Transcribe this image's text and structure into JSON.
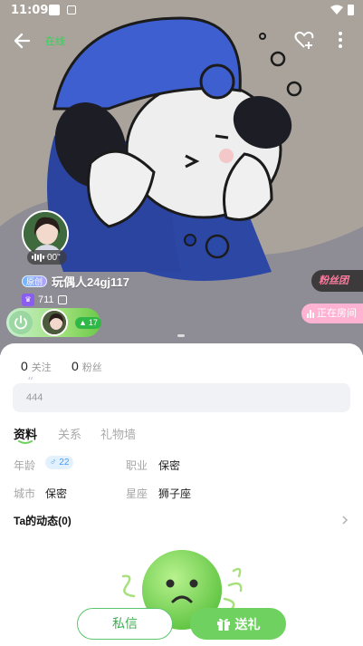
{
  "status_bar": {
    "time": "11:09"
  },
  "header": {
    "online_status": "在线"
  },
  "profile": {
    "voice_duration": "00\"",
    "vip_badge": "原创",
    "nickname": "玩偶人24gj117",
    "wealth_level": "711",
    "hot_count": "17",
    "fans_tag": "粉丝团",
    "in_room_label": "正在房间"
  },
  "stats": {
    "following_count": "0",
    "following_label": "关注",
    "fans_count": "0",
    "fans_label": "粉丝"
  },
  "bio": {
    "quote_mark": "“",
    "text": "444"
  },
  "tabs": [
    {
      "label": "资料",
      "active": true
    },
    {
      "label": "关系",
      "active": false
    },
    {
      "label": "礼物墙",
      "active": false
    }
  ],
  "details": {
    "age_label": "年龄",
    "age_value": "♂ 22",
    "job_label": "职业",
    "job_value": "保密",
    "city_label": "城市",
    "city_value": "保密",
    "sign_label": "星座",
    "sign_value": "狮子座"
  },
  "moments": {
    "title": "Ta的动态(0)"
  },
  "actions": {
    "message_label": "私信",
    "gift_label": "送礼"
  },
  "colors": {
    "accent_green": "#6fd260",
    "online_green": "#39d05c",
    "fans_pink": "#ff7ca0",
    "in_room_pink": "#ffb2d2",
    "hero_blue": "#2f4fb0"
  }
}
